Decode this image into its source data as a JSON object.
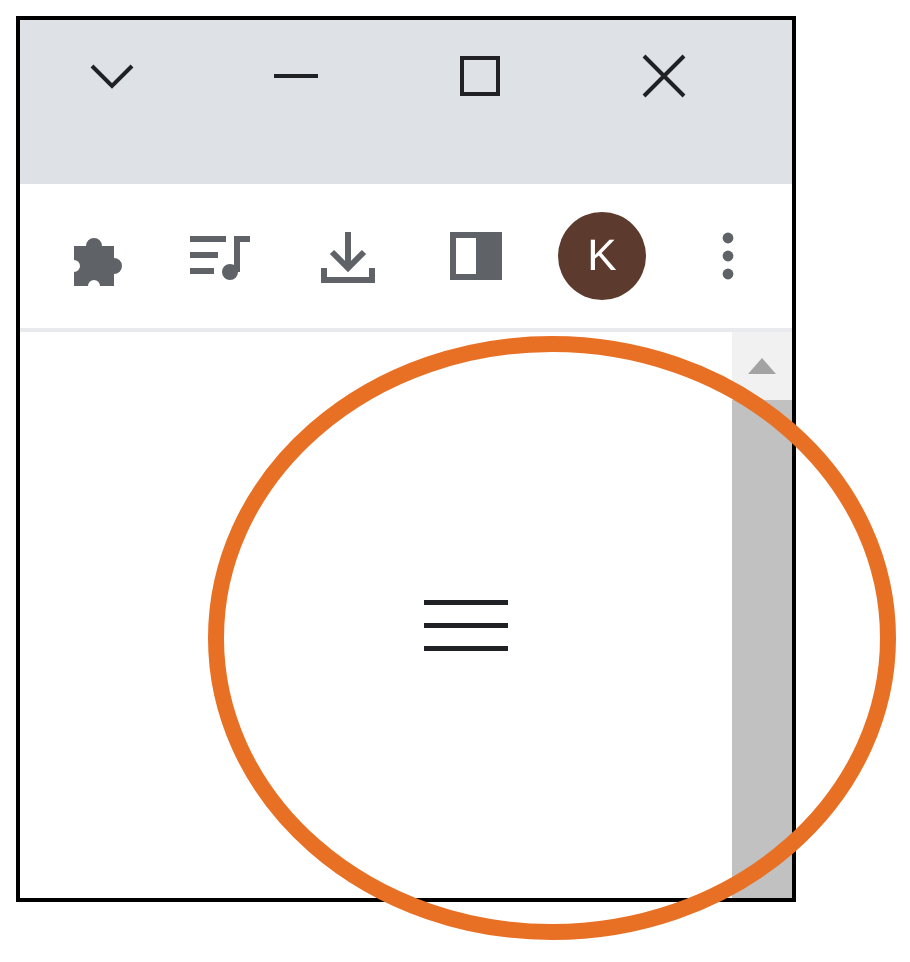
{
  "profile": {
    "initial": "K"
  }
}
